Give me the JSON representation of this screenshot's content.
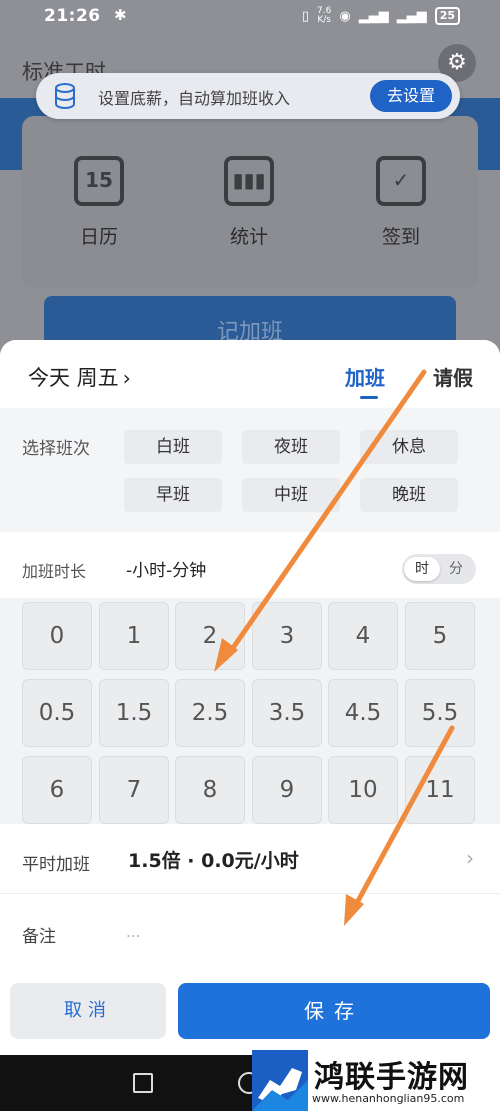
{
  "status_bar": {
    "time": "21:26",
    "speed_top": "7.6",
    "speed_bottom": "K/s",
    "battery": "25"
  },
  "background": {
    "title": "标准工时",
    "features": [
      {
        "label": "日历",
        "icon": "calendar-icon",
        "icon_text": "15"
      },
      {
        "label": "统计",
        "icon": "bar-chart-icon"
      },
      {
        "label": "签到",
        "icon": "checkin-icon"
      }
    ],
    "record_button": "记加班"
  },
  "banner": {
    "text": "设置底薪，自动算加班收入",
    "button": "去设置"
  },
  "sheet": {
    "date": "今天  周五",
    "tabs": [
      {
        "label": "加班",
        "active": true
      },
      {
        "label": "请假",
        "active": false
      }
    ],
    "shift_label": "选择班次",
    "shifts": [
      "白班",
      "夜班",
      "休息",
      "早班",
      "中班",
      "晚班"
    ],
    "duration_label": "加班时长",
    "duration_value": "-小时-分钟",
    "toggle": {
      "hour": "时",
      "minute": "分"
    },
    "keys": [
      [
        "0",
        "1",
        "2",
        "3",
        "4",
        "5"
      ],
      [
        "0.5",
        "1.5",
        "2.5",
        "3.5",
        "4.5",
        "5.5"
      ],
      [
        "6",
        "7",
        "8",
        "9",
        "10",
        "11"
      ]
    ],
    "overtime_label": "平时加班",
    "overtime_value": "1.5倍 · 0.0元/小时",
    "note_label": "备注",
    "note_placeholder": "...",
    "cancel": "取消",
    "save": "保存"
  },
  "watermark": {
    "title": "鸿联手游网",
    "url": "www.henanhonglian95.com"
  },
  "colors": {
    "accent": "#1f63c7",
    "save_blue": "#1f72d9",
    "annotation_orange": "#f08a3c"
  }
}
